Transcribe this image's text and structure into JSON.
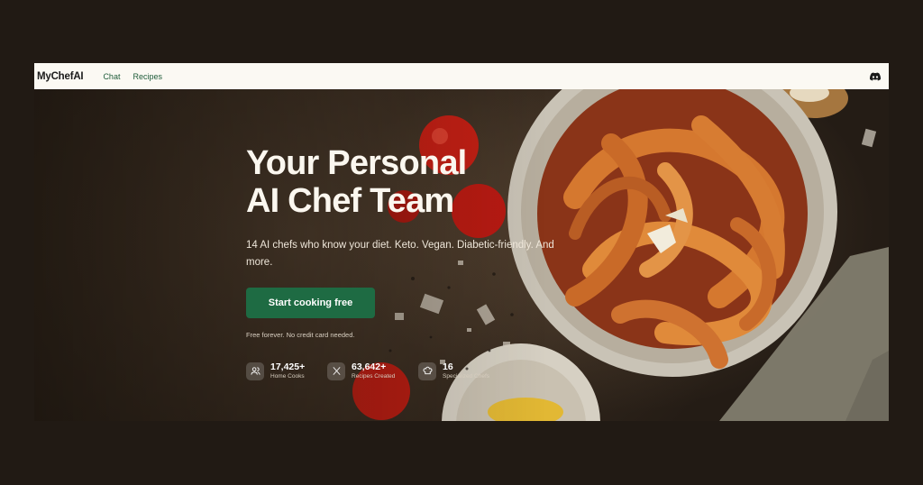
{
  "nav": {
    "brand": "MyChefAI",
    "links": [
      "Chat",
      "Recipes"
    ],
    "discord_icon": "discord-icon"
  },
  "hero": {
    "headline_line1": "Your Personal",
    "headline_line2": "AI Chef Team",
    "subtitle": "14 AI chefs who know your diet. Keto. Vegan. Diabetic-friendly. And more.",
    "cta_label": "Start cooking free",
    "fine_print": "Free forever. No credit card needed."
  },
  "stats": [
    {
      "icon": "users-icon",
      "value": "17,425+",
      "label": "Home Cooks"
    },
    {
      "icon": "utensils-icon",
      "value": "63,642+",
      "label": "Recipes Created"
    },
    {
      "icon": "chef-hat-icon",
      "value": "16",
      "label": "Specialized Chefs"
    }
  ],
  "colors": {
    "page_background": "#211a14",
    "nav_background": "#fbf9f3",
    "accent_green": "#1e6b43",
    "nav_link": "#1f5c3a"
  }
}
